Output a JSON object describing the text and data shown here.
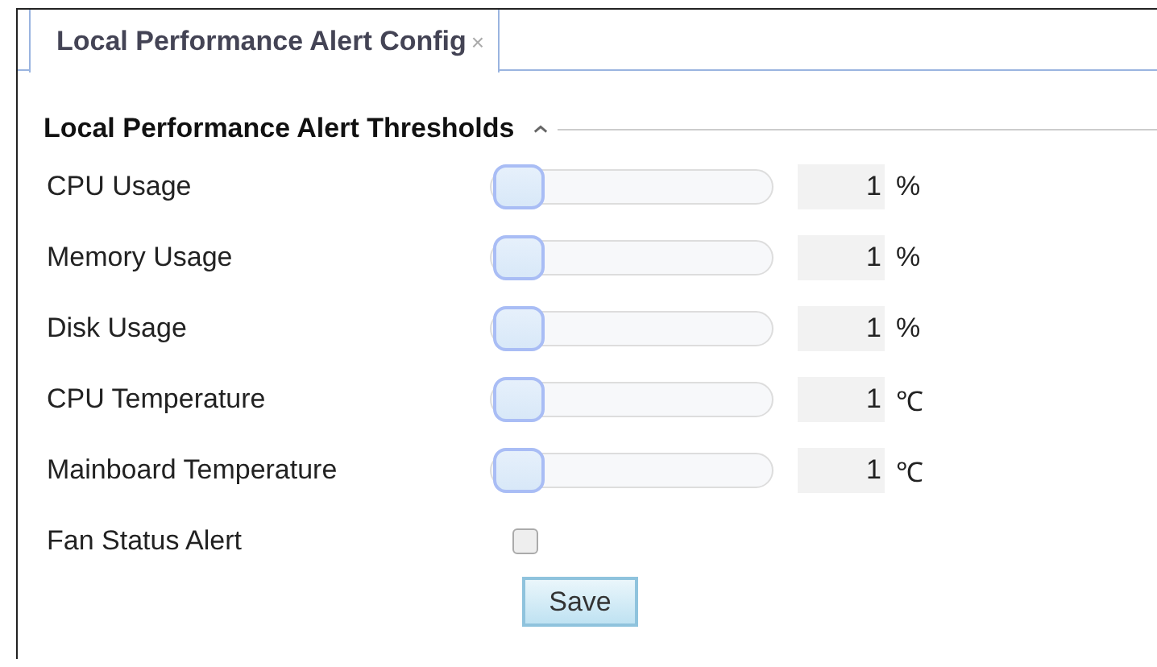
{
  "tabs": [
    {
      "label": "Local Performance Alert Config",
      "close": "×",
      "selected": true
    }
  ],
  "section": {
    "title": "Local Performance Alert Thresholds",
    "expanded": true
  },
  "rows": [
    {
      "kind": "slider",
      "label": "CPU Usage",
      "level": 0.01,
      "value": "1",
      "unit": "%"
    },
    {
      "kind": "slider",
      "label": "Memory Usage",
      "level": 0.01,
      "value": "1",
      "unit": "%"
    },
    {
      "kind": "slider",
      "label": "Disk Usage",
      "level": 0.01,
      "value": "1",
      "unit": "%"
    },
    {
      "kind": "slider",
      "label": "CPU Temperature",
      "level": 0.01,
      "value": "1",
      "unit": "℃"
    },
    {
      "kind": "slider",
      "label": "Mainboard Temperature",
      "level": 0.01,
      "value": "1",
      "unit": "℃"
    },
    {
      "kind": "checkbox",
      "label": "Fan Status Alert",
      "checked": false
    }
  ],
  "buttons": [
    "Save"
  ]
}
